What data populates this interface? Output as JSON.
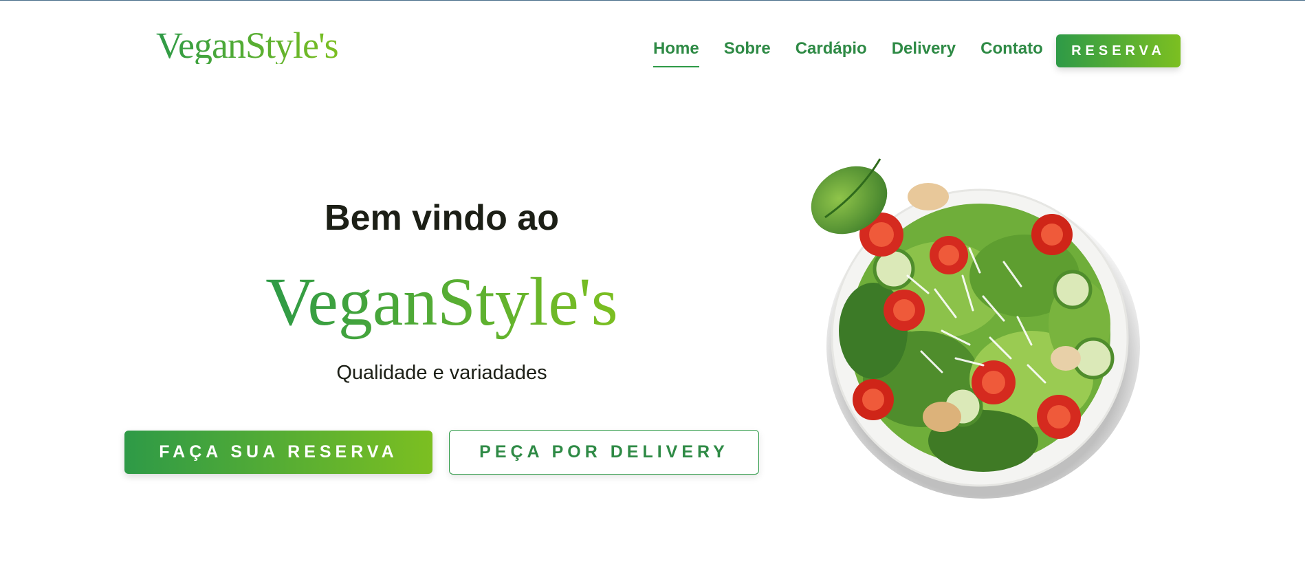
{
  "header": {
    "logo": "VeganStyle's",
    "nav": [
      {
        "label": "Home",
        "active": true
      },
      {
        "label": "Sobre"
      },
      {
        "label": "Cardápio"
      },
      {
        "label": "Delivery"
      },
      {
        "label": "Contato"
      }
    ],
    "reserve_label": "RESERVA"
  },
  "hero": {
    "welcome": "Bem vindo ao",
    "brand": "VeganStyle's",
    "tagline": "Qualidade e variadades",
    "primary_button": "FAÇA SUA RESERVA",
    "secondary_button": "PEÇA POR DELIVERY",
    "image": "salad-bowl"
  },
  "colors": {
    "primary": "#2e9a47",
    "accent": "#7cbf21",
    "text_dark": "#1c1f16"
  }
}
